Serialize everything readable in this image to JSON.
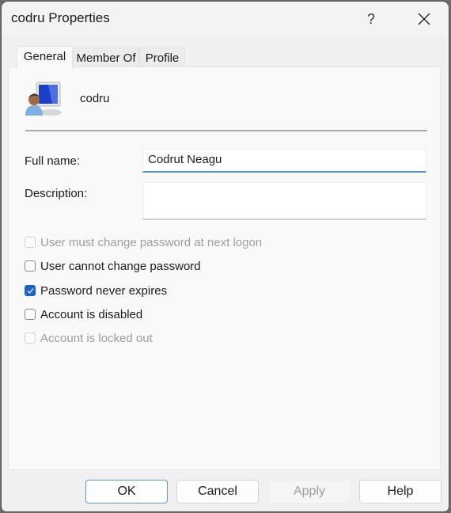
{
  "window": {
    "title": "codru Properties",
    "help_label": "?",
    "close_icon": "close-icon"
  },
  "tabs": [
    {
      "label": "General",
      "active": true
    },
    {
      "label": "Member Of",
      "active": false
    },
    {
      "label": "Profile",
      "active": false
    }
  ],
  "general": {
    "user_icon": "user-computer-icon",
    "username": "codru",
    "full_name_label": "Full name:",
    "full_name_value": "Codrut Neagu",
    "description_label": "Description:",
    "description_value": "",
    "checkboxes": [
      {
        "label": "User must change password at next logon",
        "checked": false,
        "disabled": true
      },
      {
        "label": "User cannot change password",
        "checked": false,
        "disabled": false
      },
      {
        "label": "Password never expires",
        "checked": true,
        "disabled": false
      },
      {
        "label": "Account is disabled",
        "checked": false,
        "disabled": false
      },
      {
        "label": "Account is locked out",
        "checked": false,
        "disabled": true
      }
    ]
  },
  "buttons": {
    "ok": "OK",
    "cancel": "Cancel",
    "apply": "Apply",
    "help": "Help"
  },
  "colors": {
    "accent": "#1c63c5",
    "focus_underline": "#4f8fcf"
  }
}
